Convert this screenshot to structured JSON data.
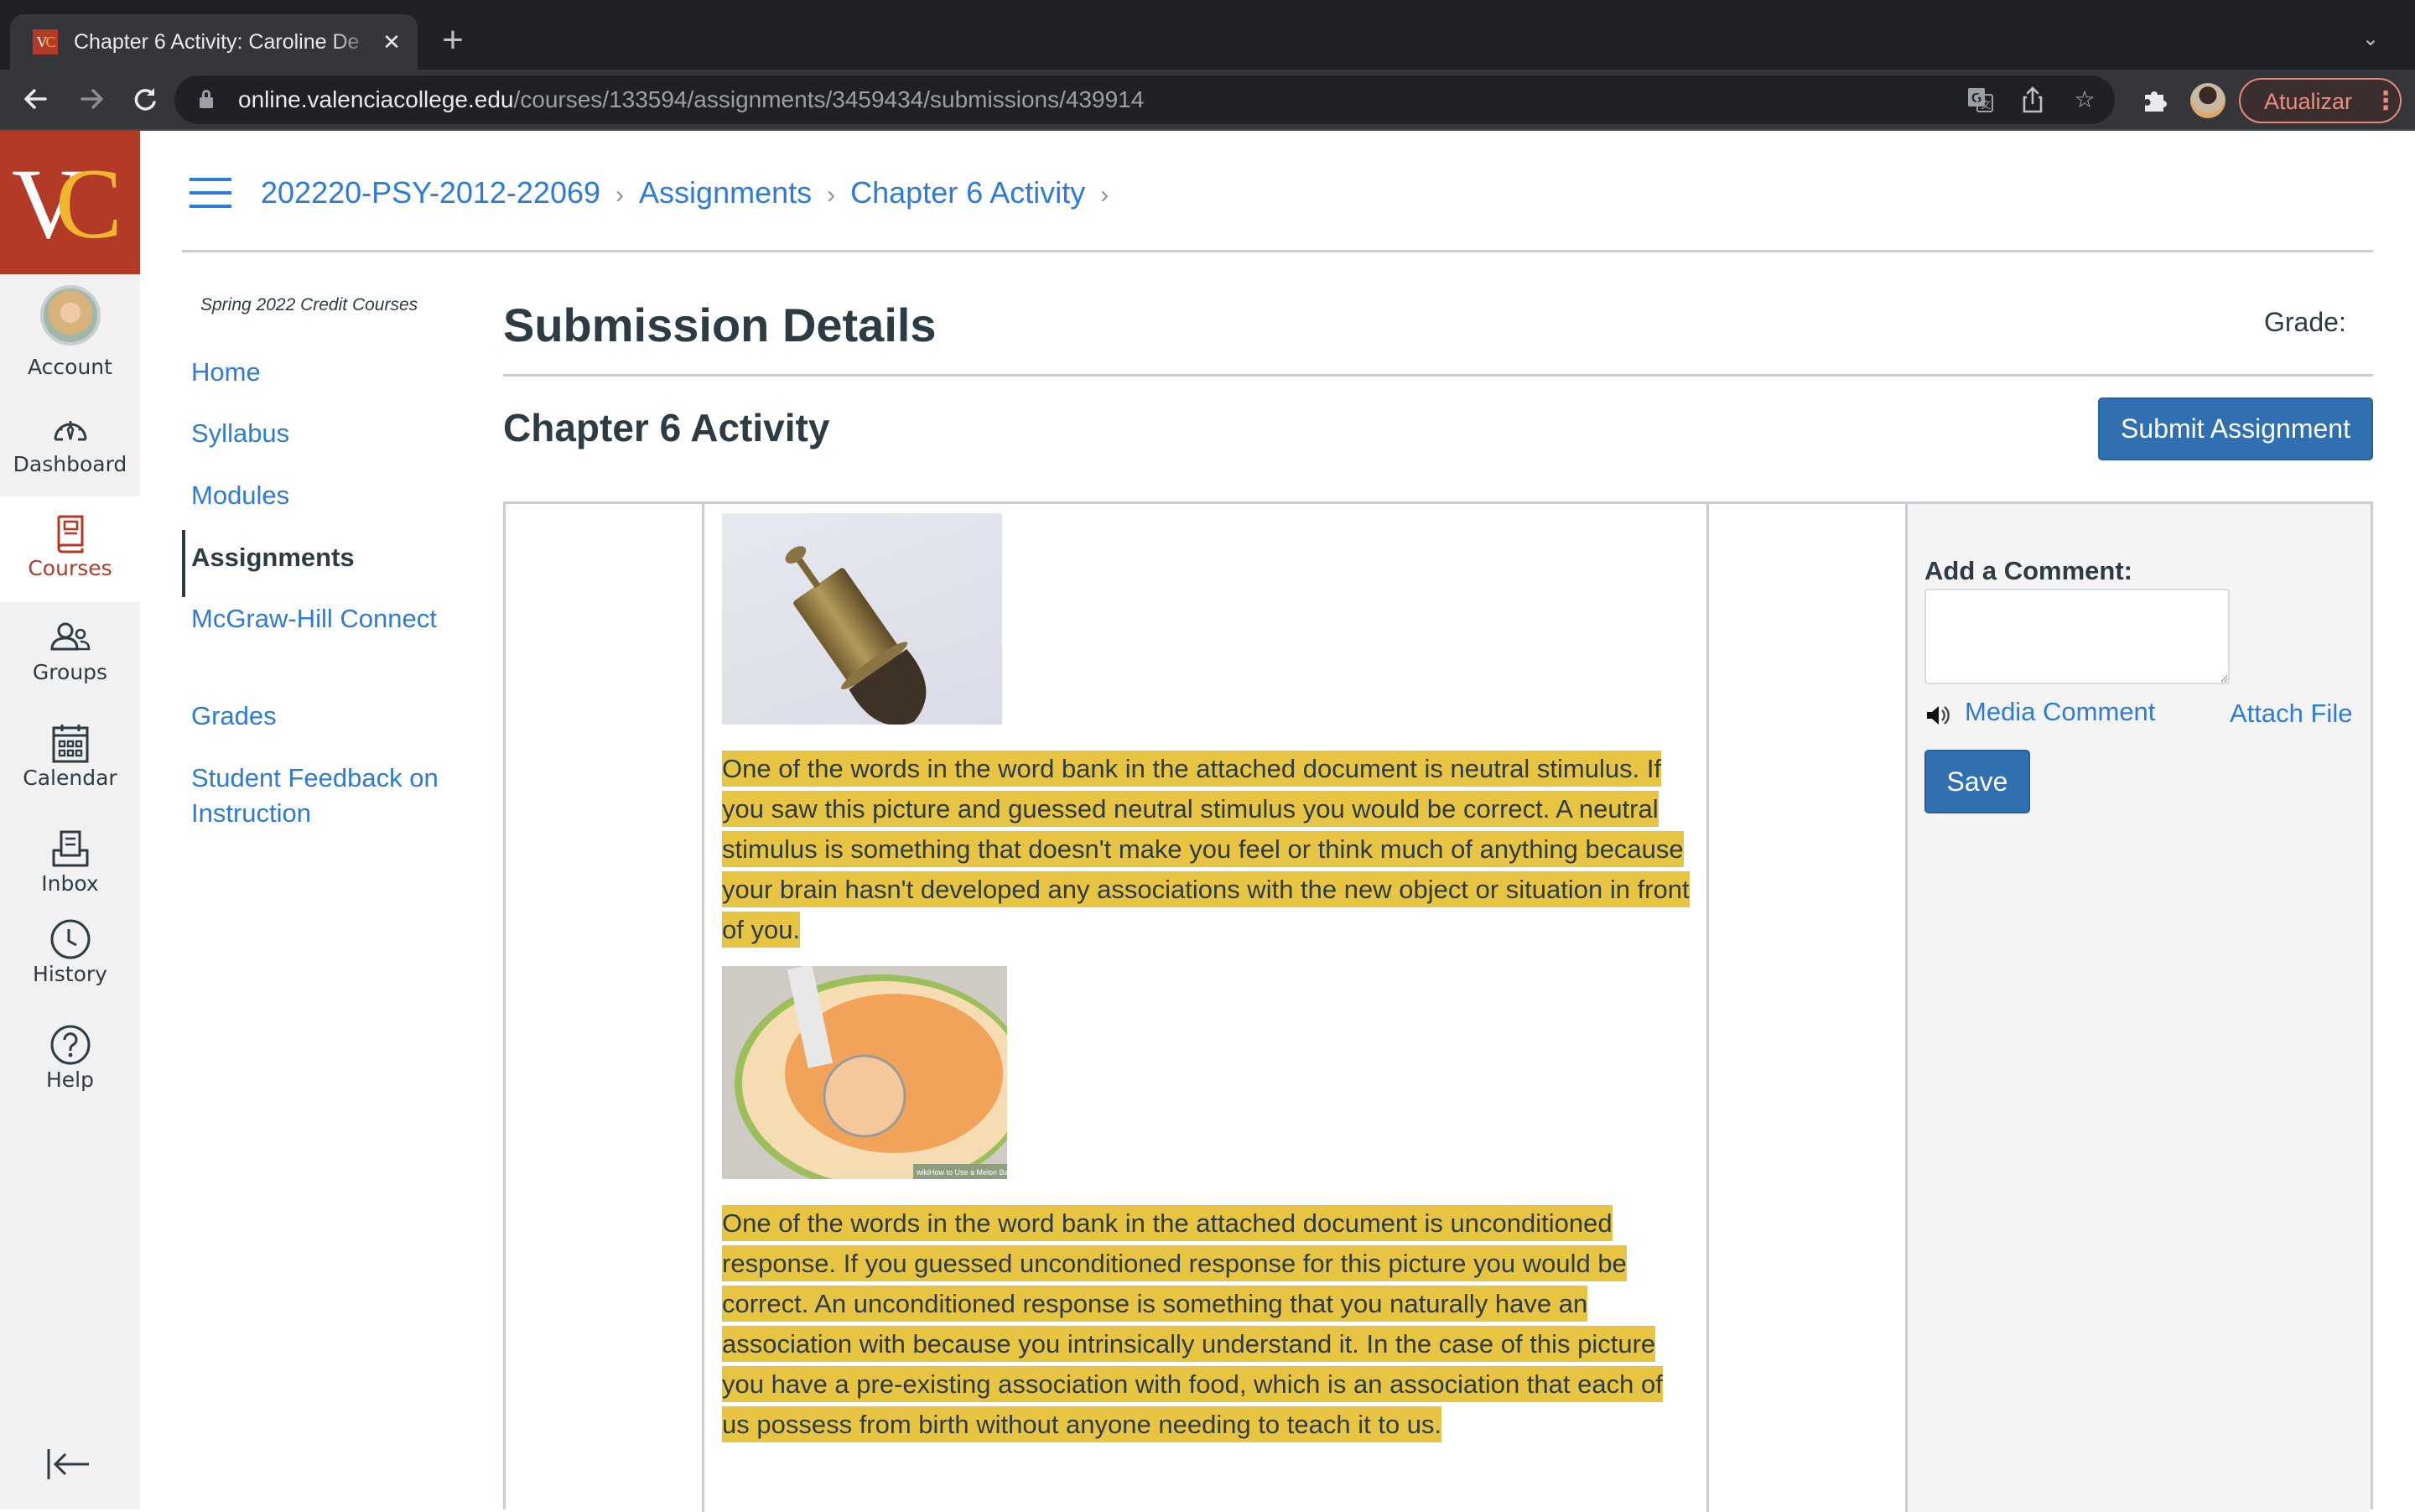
{
  "browser": {
    "tab_title": "Chapter 6 Activity: Caroline De",
    "favicon_text_v": "V",
    "favicon_text_c": "C",
    "new_tab_label": "+",
    "url_host": "online.valenciacollege.edu",
    "url_path": "/courses/133594/assignments/3459434/submissions/439914",
    "update_button": "Atualizar",
    "icons": [
      "back-icon",
      "forward-icon",
      "reload-icon",
      "lock-icon",
      "translate-icon",
      "share-icon",
      "bookmark-star-icon",
      "extensions-icon",
      "profile-avatar",
      "menu-icon",
      "tab-list-icon"
    ]
  },
  "global_nav": {
    "logo_v": "V",
    "logo_c": "C",
    "items": [
      {
        "label": "Account",
        "icon": "avatar"
      },
      {
        "label": "Dashboard",
        "icon": "dashboard-icon"
      },
      {
        "label": "Courses",
        "icon": "courses-icon",
        "active": true
      },
      {
        "label": "Groups",
        "icon": "groups-icon"
      },
      {
        "label": "Calendar",
        "icon": "calendar-icon"
      },
      {
        "label": "Inbox",
        "icon": "inbox-icon"
      },
      {
        "label": "History",
        "icon": "history-icon"
      },
      {
        "label": "Help",
        "icon": "help-icon"
      }
    ],
    "collapse_icon": "collapse-nav-icon"
  },
  "breadcrumb": {
    "items": [
      "202220-PSY-2012-22069",
      "Assignments",
      "Chapter 6 Activity"
    ],
    "separator": "›"
  },
  "course_nav": {
    "term": "Spring 2022 Credit Courses",
    "items": [
      {
        "label": "Home"
      },
      {
        "label": "Syllabus"
      },
      {
        "label": "Modules"
      },
      {
        "label": "Assignments",
        "active": true
      },
      {
        "label": "McGraw-Hill Connect"
      },
      {
        "label": "Grades"
      },
      {
        "label": "Student Feedback on Instruction"
      }
    ]
  },
  "main": {
    "page_title": "Submission Details",
    "grade_label": "Grade:",
    "assignment_title": "Chapter 6 Activity",
    "submit_button": "Submit Assignment",
    "submission": {
      "images": [
        {
          "name": "brass-brush-image",
          "description": "Antique brass cylinder brush"
        },
        {
          "name": "melon-baller-image",
          "description": "Melon baller scooping cantaloupe",
          "watermark": "wikiHow to Use a Melon Baller"
        }
      ],
      "paragraphs": [
        "One of the words in the word bank in the attached document is neutral stimulus. If you saw this picture and guessed neutral stimulus you would be correct. A neutral stimulus is something that doesn't make you feel or think much of anything because your brain hasn't developed any associations with the new object or situation in front of you.",
        "One of the words in the word bank in the attached document is unconditioned response. If you guessed unconditioned response for this picture you would be correct. An unconditioned response is something that you naturally have an association with because you intrinsically understand it. In the case of this picture you have a pre-existing association with food, which is an association that each of us possess from birth without anyone needing to teach it to us."
      ],
      "highlight_color": "#e8c443"
    },
    "comments": {
      "label": "Add a Comment:",
      "input_value": "",
      "media_comment": "Media Comment",
      "attach_file": "Attach File",
      "save_button": "Save"
    }
  },
  "colors": {
    "brand_red": "#b23a26",
    "brand_gold": "#f1b52f",
    "link_blue": "#2d7bd8",
    "button_blue": "#3170b0",
    "text_dark": "#2d3b45"
  }
}
